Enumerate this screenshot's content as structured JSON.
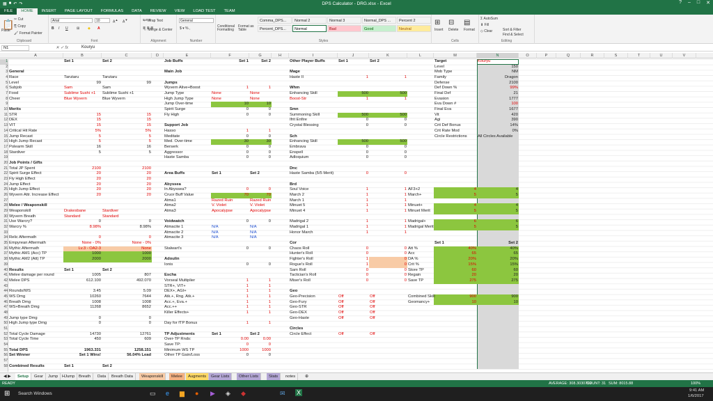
{
  "window": {
    "title": "DPS Calculator - DRG.xlsx - Excel"
  },
  "ribbon": {
    "tabs": [
      "FILE",
      "HOME",
      "INSERT",
      "PAGE LAYOUT",
      "FORMULAS",
      "DATA",
      "REVIEW",
      "VIEW",
      "LOAD TEST",
      "TEAM"
    ],
    "active_tab": "HOME",
    "clipboard": {
      "paste": "Paste",
      "cut": "Cut",
      "copy": "Copy",
      "format_painter": "Format Painter",
      "label": "Clipboard"
    },
    "font": {
      "name": "Arial",
      "size": "10",
      "label": "Font"
    },
    "alignment": {
      "wrap": "Wrap Text",
      "merge": "Merge & Center",
      "label": "Alignment"
    },
    "number": {
      "format": "General",
      "label": "Number"
    },
    "styles": {
      "cond": "Conditional Formatting",
      "table": "Format as Table",
      "cells": [
        "Comma_DPS...",
        "Normal 2",
        "Normal 3",
        "Normal_DPS ...",
        "Percent 2",
        "Percent_DPS...",
        "Normal",
        "Bad",
        "Good",
        "Neutral"
      ],
      "label": "Styles"
    },
    "cells_grp": {
      "insert": "Insert",
      "delete": "Delete",
      "format": "Format",
      "label": "Cells"
    },
    "editing": {
      "autosum": "AutoSum",
      "fill": "Fill",
      "clear": "Clear",
      "sort": "Sort & Filter",
      "find": "Find & Select",
      "label": "Editing"
    }
  },
  "formula_bar": {
    "name_box": "N1",
    "value": "Kouryu"
  },
  "columns": [
    "A",
    "B",
    "C",
    "D",
    "E",
    "F",
    "G",
    "H",
    "I",
    "J",
    "K",
    "L",
    "M",
    "N",
    "O",
    "P",
    "Q",
    "R",
    "S",
    "T",
    "U",
    "V"
  ],
  "rows": [
    "1",
    "2",
    "3",
    "4",
    "5",
    "6",
    "7",
    "8",
    "9",
    "10",
    "11",
    "12",
    "13",
    "14",
    "15",
    "16",
    "17",
    "18",
    "19",
    "20",
    "21",
    "22",
    "23",
    "24",
    "25",
    "26",
    "27",
    "28",
    "29",
    "30",
    "31",
    "32",
    "33",
    "34",
    "35",
    "36",
    "37",
    "38",
    "39",
    "40",
    "41",
    "42",
    "43",
    "44",
    "45",
    "46",
    "47",
    "48",
    "49",
    "50",
    "51",
    "52",
    "53",
    "54",
    "55",
    "56",
    "57",
    "58"
  ],
  "cells": {
    "A": {
      "3": "General",
      "4": "Race",
      "5": "Level",
      "6": "Subjob",
      "7": "Food",
      "8": "Cheer",
      "10": "Merits",
      "11": "STR",
      "12": "DEX",
      "13": "VIT",
      "14": "Critical Hit Rate",
      "15": "Jump Recast",
      "16": "High Jump Recast",
      "17": "Polearm Skill",
      "18": "Stardiver",
      "20": "Job Points / Gifts",
      "21": "Total JP Spent",
      "22": "Spirit Surge Effect",
      "23": "Fly High Effect",
      "24": "Jump Effect",
      "25": "High Jump Effect",
      "26": "Wyvern Attr. Increase Effect",
      "28": "Melee / Weaponskill",
      "29": "Weaponskill",
      "30": "Wyvern Breath",
      "31": "Use Warcry?",
      "32": "Warcry %",
      "34": "Relic Aftermath",
      "35": "Empyrean Aftermath",
      "36": "Mythic Aftermath",
      "37": "Mythic AM1 (Acc) TP",
      "38": "Mythic AM2 (Att) TP",
      "40": "Results",
      "41": "Melee damage per round",
      "42": "Melee DPS",
      "44": "Rounds/WS",
      "45": "WS Dmg",
      "46": "Breath Dmg",
      "47": "WS+Breath Dmg",
      "49": "Jump type Dmg",
      "50": "High Jump type Dmg",
      "52": "Total Cycle Damage",
      "53": "Total Cycle Time",
      "55": "Total DPS",
      "56": "Set Winner",
      "58": "Combined Results"
    },
    "B": {
      "1": "Set 1",
      "4": "Tarutaru",
      "5": "99",
      "6": "Sam",
      "7": "Sublime Sushi +1",
      "8": "Blue Wyvern",
      "11": "15",
      "12": "15",
      "13": "15",
      "14": "5%",
      "15": "5",
      "16": "5",
      "17": "16",
      "18": "5",
      "21": "2100",
      "22": "20",
      "23": "20",
      "24": "20",
      "25": "20",
      "26": "20",
      "29": "Drakesbane",
      "30": "Standard",
      "31": "0",
      "32": "8.98%",
      "34": "0",
      "35": "None - 0%",
      "36": "Lv.3 - OA2-3",
      "37": "1000",
      "38": "2000",
      "40": "Set 1",
      "41": "1005",
      "42": "612.100",
      "44": "3.45",
      "45": "10260",
      "46": "1008",
      "47": "11268",
      "49": "0",
      "50": "0",
      "52": "14730",
      "53": "450",
      "55": "1963.331",
      "56": "Set 1 Wins!",
      "58": "Set 1"
    },
    "C": {
      "1": "Set 2",
      "4": "Tarutaru",
      "5": "99",
      "6": "Sam",
      "7": "Sublime Sushi +1",
      "8": "Blue Wyvern",
      "11": "15",
      "12": "15",
      "13": "15",
      "14": "5%",
      "15": "5",
      "16": "5",
      "17": "16",
      "18": "5",
      "21": "2100",
      "22": "20",
      "23": "20",
      "24": "20",
      "25": "20",
      "26": "20",
      "29": "Stardiver",
      "30": "Standard",
      "31": "0",
      "32": "8.98%",
      "34": "0",
      "35": "None - 0%",
      "36": "None",
      "37": "1000",
      "38": "2000",
      "40": "Set 2",
      "41": "807",
      "42": "492.070",
      "44": "5.09",
      "45": "7644",
      "46": "1008",
      "47": "8652",
      "49": "0",
      "50": "0",
      "52": "12761",
      "53": "609",
      "55": "1258.151",
      "56": "56.04% Lead",
      "58": "Set 2"
    },
    "E": {
      "1": "Job Buffs",
      "3": "Main Job",
      "5": "Jumps",
      "6": "Wyvern Alive+Boost",
      "7": "Jump Type",
      "8": "High Jump Type",
      "9": "Jump Over-time",
      "10": "Spirit Surge",
      "11": "Fly High",
      "13": "Support Job",
      "14": "Hasso",
      "15": "Meditate",
      "16": "Med. Over-time",
      "17": "Berserk",
      "18": "Aggressor",
      "19": "Haste Samba",
      "22": "Area Buffs",
      "24": "Abyssea",
      "25": "In Abyssea?",
      "26": "Cruor Buff Value",
      "27": "Atma1",
      "28": "Atma2",
      "29": "Atma3",
      "31": "Voidwatch",
      "32": "Atmacite 1",
      "33": "Atmacite 2",
      "34": "Atmacite 3",
      "36": "Stalwart's",
      "38": "Adoulin",
      "39": "Ionis",
      "41": "Escha",
      "42": "Vorseal Multiplier",
      "43": "STR+, VIT+",
      "44": "DEX+, AGI+",
      "45": "Atk.+, Rng. Atk.+",
      "46": "Acc.+, Eva.+",
      "47": "Acc.++",
      "48": "Killer Effects+",
      "50": "Day for fTP Bonus",
      "52": "TP Adjustments",
      "53": "Over-TP Rnds:",
      "54": "Save TP:",
      "55": "Minimum WS TP",
      "56": "Other TP Gain/Loss"
    },
    "F": {
      "1": "Set 1",
      "6": "1",
      "7": "None",
      "8": "None",
      "9": "10",
      "10": "0",
      "11": "0",
      "14": "1",
      "15": "0",
      "16": "30",
      "17": "0",
      "18": "0",
      "19": "0",
      "22": "Set 1",
      "25": "0",
      "26": "70",
      "27": "Razed Ruin",
      "28": "V. Violet",
      "29": "Apocalypse",
      "31": "0",
      "32": "N/A",
      "33": "N/A",
      "34": "N/A",
      "36": "0",
      "39": "0",
      "42": "1",
      "43": "1",
      "44": "1",
      "45": "1",
      "46": "1",
      "47": "1",
      "48": "1",
      "50": "1",
      "52": "Set 1",
      "53": "0.00",
      "54": "0",
      "55": "1000",
      "56": "0"
    },
    "G": {
      "1": "Set 2",
      "6": "1",
      "7": "None",
      "8": "None",
      "9": "10",
      "10": "0",
      "11": "0",
      "14": "1",
      "15": "0",
      "16": "30",
      "17": "0",
      "18": "0",
      "19": "0",
      "22": "Set 2",
      "25": "0",
      "26": "70",
      "27": "Razed Ruin",
      "28": "V. Violet",
      "29": "Apocalypse",
      "31": "0",
      "32": "N/A",
      "33": "N/A",
      "34": "N/A",
      "36": "0",
      "39": "0",
      "42": "1",
      "43": "1",
      "44": "1",
      "45": "1",
      "46": "1",
      "47": "1",
      "48": "1",
      "50": "1",
      "52": "Set 2",
      "53": "0.00",
      "54": "0",
      "55": "1000",
      "56": "0"
    },
    "I": {
      "1": "Other Player Buffs",
      "3": "Mage",
      "4": "Haste II",
      "6": "Whm",
      "7": "Enhancing Skill",
      "8": "Boost-Str",
      "10": "Smn",
      "11": "Summoning Skill",
      "12": "Ifrit Enfire",
      "13": "Crystal Blessing",
      "15": "Sch",
      "16": "Enhancing Skill",
      "17": "Embrava",
      "18": "Enspell",
      "19": "Adloquium",
      "21": "Dnc",
      "22": "Haste Samba (5/5 Merit)",
      "24": "Brd",
      "25": "Soul Voice",
      "26": "March 2",
      "27": "March 1",
      "28": "Minuet 5",
      "29": "Minuet 4",
      "31": "Madrigal 2",
      "32": "Madrigal 1",
      "33": "Honor March",
      "35": "Cor",
      "36": "Chaos Roll",
      "37": "Hunter's Roll",
      "38": "Fighter's Roll",
      "39": "Rogue's Roll",
      "40": "Sam Roll",
      "41": "Tactician's Roll",
      "42": "Miser's Roll",
      "44": "Geo",
      "45": "Geo-Precision",
      "46": "Geo-Fury",
      "47": "Geo-STR",
      "48": "Geo-DEX",
      "49": "Geo-Haste",
      "51": "Circles",
      "52": "Circle Effect"
    },
    "J": {
      "1": "Set 1",
      "4": "1",
      "7": "500",
      "8": "1",
      "11": "500",
      "12": "0",
      "13": "0",
      "16": "500",
      "17": "0",
      "18": "0",
      "19": "0",
      "22": "0",
      "25": "1",
      "26": "1",
      "27": "1",
      "28": "1",
      "29": "1",
      "31": "1",
      "32": "1",
      "33": "1",
      "36": "0",
      "37": "0",
      "38": "1",
      "39": "1",
      "40": "0",
      "41": "0",
      "42": "0",
      "45": "Off",
      "46": "Off",
      "47": "Off",
      "48": "Off",
      "49": "Off",
      "52": "Off"
    },
    "K": {
      "1": "Set 2",
      "4": "1",
      "7": "500",
      "8": "1",
      "11": "500",
      "12": "0",
      "13": "0",
      "16": "500",
      "17": "0",
      "18": "0",
      "19": "0",
      "22": "0",
      "25": "1",
      "26": "1",
      "27": "1",
      "28": "1",
      "29": "1",
      "31": "1",
      "32": "1",
      "33": "1",
      "36": "0",
      "37": "0",
      "38": "0",
      "39": "0",
      "40": "0",
      "41": "0",
      "42": "0",
      "45": "Off",
      "46": "Off",
      "47": "Off",
      "48": "Off",
      "49": "Off",
      "52": "Off"
    },
    "L": {
      "25": "AF3+2",
      "26": "March+",
      "28": "Minuet+",
      "29": "Minuet Merit",
      "31": "Madrigal+",
      "32": "Madrigal Merit",
      "36": "Att %",
      "37": "Acc",
      "38": "DA %",
      "39": "Crit %",
      "40": "Store TP",
      "41": "Regain",
      "42": "Save TP",
      "45": "Combined Skill",
      "46": "Geomancy+"
    },
    "M": {
      "1": "Target",
      "2": "Level",
      "3": "Mob Type",
      "4": "Family",
      "5": "Defense",
      "6": "Def Down %",
      "7": "Final Def",
      "8": "Evasion",
      "9": "Eva Down #",
      "10": "Final Eva",
      "11": "Vit",
      "12": "Agi",
      "13": "Crit Def Bonus",
      "14": "Crit Rate Mod",
      "15": "Circle Restrictions",
      "25": "4",
      "26": "5",
      "28": "4",
      "29": "5",
      "31": "6",
      "32": "5",
      "35": "Set 1",
      "36": "40%",
      "37": "65",
      "38": "20%",
      "39": "15%",
      "40": "60",
      "41": "20",
      "42": "275",
      "45": "900",
      "46": "10"
    },
    "N": {
      "1": "Kouryu",
      "2": "150",
      "3": "NM",
      "4": "Dragon",
      "5": "2100",
      "6": "99%",
      "7": "21",
      "8": "1777",
      "9": "100",
      "10": "1677",
      "11": "420",
      "12": "390",
      "13": "14%",
      "14": "0%",
      "15": "All Circles Available",
      "25": "4",
      "26": "5",
      "28": "4",
      "29": "5",
      "31": "6",
      "32": "5",
      "35": "Set 2",
      "36": "40%",
      "37": "65",
      "38": "20%",
      "39": "15%",
      "40": "60",
      "41": "20",
      "42": "275",
      "45": "900",
      "46": "10"
    }
  },
  "sheet_tabs": [
    "Setup",
    "Gear",
    "Jump",
    "HJump",
    "Breath",
    "Data",
    "Breath Data",
    "Weaponskill",
    "Melee",
    "Augments",
    "Gear Lists",
    "Other Lists",
    "Stats",
    "notes"
  ],
  "active_sheet": "Setup",
  "status": {
    "ready": "READY",
    "average": "AVERAGE: 308.3030769",
    "count": "COUNT: 31",
    "sum": "SUM: 8015.88",
    "zoom": "100%"
  },
  "taskbar": {
    "search": "Search Windows",
    "time": "9:41 AM",
    "date": "1/6/2017"
  },
  "colors": {
    "excel_green": "#217346",
    "red": "#e00000",
    "green_fill": "#8cc63f",
    "orange_fill": "#f8cba6",
    "gray_fill": "#d9d9d9"
  }
}
